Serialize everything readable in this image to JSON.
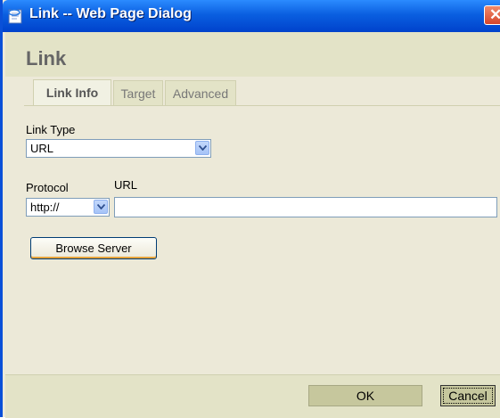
{
  "window": {
    "title": "Link -- Web Page Dialog",
    "icon": "ie-page-icon",
    "close_label": "✕"
  },
  "dialog": {
    "heading": "Link",
    "tabs": [
      {
        "label": "Link Info",
        "active": true
      },
      {
        "label": "Target",
        "active": false
      },
      {
        "label": "Advanced",
        "active": false
      }
    ]
  },
  "form": {
    "link_type_label": "Link Type",
    "link_type_value": "URL",
    "protocol_label": "Protocol",
    "protocol_value": "http://",
    "url_label": "URL",
    "url_value": "",
    "browse_label": "Browse Server"
  },
  "footer": {
    "ok_label": "OK",
    "cancel_label": "Cancel"
  },
  "colors": {
    "titlebar": "#0a5fe0",
    "dialog_bg": "#ece9d8",
    "panel_bg": "#e3e3c7",
    "button_bg": "#c6c79d"
  }
}
